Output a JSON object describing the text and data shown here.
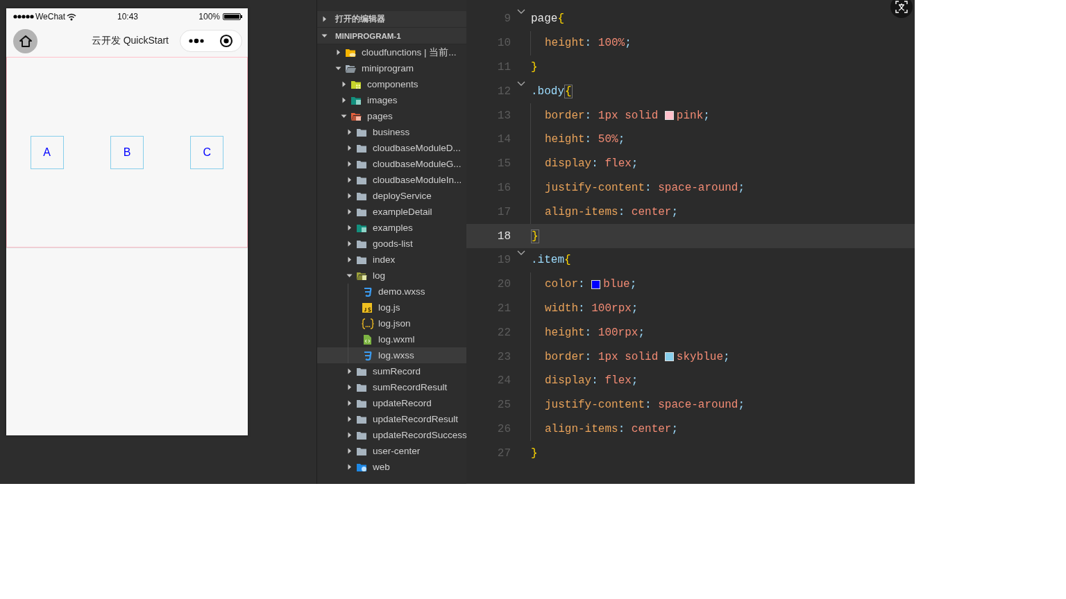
{
  "simulator": {
    "status_bar": {
      "carrier": "WeChat",
      "time": "10:43",
      "battery": "100%"
    },
    "nav_title": "云开发 QuickStart",
    "items": [
      {
        "label": "A"
      },
      {
        "label": "B"
      },
      {
        "label": "C"
      }
    ]
  },
  "explorer": {
    "sections": [
      {
        "label": "打开的编辑器",
        "expanded": false,
        "selected": false
      },
      {
        "label": "MINIPROGRAM-1",
        "expanded": true,
        "selected": false,
        "children": [
          {
            "label": "cloudfunctions | 当前...",
            "kind": "folder-cloud",
            "expanded": false,
            "selected": false
          },
          {
            "label": "miniprogram",
            "kind": "folder",
            "expanded": true,
            "selected": false,
            "children": [
              {
                "label": "components",
                "kind": "folder-components",
                "expanded": false,
                "selected": false
              },
              {
                "label": "images",
                "kind": "folder-images",
                "expanded": false,
                "selected": false
              },
              {
                "label": "pages",
                "kind": "folder-pages",
                "expanded": true,
                "selected": false,
                "children": [
                  {
                    "label": "business",
                    "kind": "folder",
                    "expanded": false,
                    "selected": false
                  },
                  {
                    "label": "cloudbaseModuleD...",
                    "kind": "folder",
                    "expanded": false,
                    "selected": false
                  },
                  {
                    "label": "cloudbaseModuleG...",
                    "kind": "folder",
                    "expanded": false,
                    "selected": false
                  },
                  {
                    "label": "cloudbaseModuleIn...",
                    "kind": "folder",
                    "expanded": false,
                    "selected": false
                  },
                  {
                    "label": "deployService",
                    "kind": "folder",
                    "expanded": false,
                    "selected": false
                  },
                  {
                    "label": "exampleDetail",
                    "kind": "folder",
                    "expanded": false,
                    "selected": false
                  },
                  {
                    "label": "examples",
                    "kind": "folder-images",
                    "expanded": false,
                    "selected": false
                  },
                  {
                    "label": "goods-list",
                    "kind": "folder",
                    "expanded": false,
                    "selected": false
                  },
                  {
                    "label": "index",
                    "kind": "folder",
                    "expanded": false,
                    "selected": false
                  },
                  {
                    "label": "log",
                    "kind": "folder-log",
                    "expanded": true,
                    "selected": false,
                    "children": [
                      {
                        "label": "demo.wxss",
                        "kind": "css",
                        "selected": false
                      },
                      {
                        "label": "log.js",
                        "kind": "js",
                        "selected": false
                      },
                      {
                        "label": "log.json",
                        "kind": "json",
                        "selected": false
                      },
                      {
                        "label": "log.wxml",
                        "kind": "wxml",
                        "selected": false
                      },
                      {
                        "label": "log.wxss",
                        "kind": "css",
                        "selected": true
                      }
                    ]
                  },
                  {
                    "label": "sumRecord",
                    "kind": "folder",
                    "expanded": false,
                    "selected": false
                  },
                  {
                    "label": "sumRecordResult",
                    "kind": "folder",
                    "expanded": false,
                    "selected": false
                  },
                  {
                    "label": "updateRecord",
                    "kind": "folder",
                    "expanded": false,
                    "selected": false
                  },
                  {
                    "label": "updateRecordResult",
                    "kind": "folder",
                    "expanded": false,
                    "selected": false
                  },
                  {
                    "label": "updateRecordSuccess",
                    "kind": "folder",
                    "expanded": false,
                    "selected": false
                  },
                  {
                    "label": "user-center",
                    "kind": "folder",
                    "expanded": false,
                    "selected": false
                  },
                  {
                    "label": "web",
                    "kind": "folder-web",
                    "expanded": false,
                    "selected": false
                  }
                ]
              }
            ]
          }
        ]
      }
    ]
  },
  "editor": {
    "lines": [
      {
        "number": "9",
        "fold": true,
        "current": false,
        "tokens": [
          {
            "kind": "selector",
            "text": "page"
          },
          {
            "kind": "brace",
            "text": "{",
            "matched": false
          }
        ]
      },
      {
        "number": "10",
        "fold": false,
        "current": false,
        "tokens": [
          {
            "kind": "property",
            "text": "height"
          },
          {
            "kind": "punct",
            "text": ": "
          },
          {
            "kind": "value",
            "text": "100%"
          },
          {
            "kind": "punct",
            "text": ";"
          }
        ]
      },
      {
        "number": "11",
        "fold": false,
        "current": false,
        "tokens": [
          {
            "kind": "brace",
            "text": "}",
            "matched": false
          }
        ]
      },
      {
        "number": "12",
        "fold": true,
        "current": false,
        "tokens": [
          {
            "kind": "class",
            "text": ".body"
          },
          {
            "kind": "brace",
            "text": "{",
            "matched": true
          }
        ]
      },
      {
        "number": "13",
        "fold": false,
        "current": false,
        "tokens": [
          {
            "kind": "property",
            "text": "border"
          },
          {
            "kind": "punct",
            "text": ": "
          },
          {
            "kind": "value",
            "text": "1px solid "
          },
          {
            "kind": "swatch",
            "color": "#ffc0cb"
          },
          {
            "kind": "value",
            "text": "pink"
          },
          {
            "kind": "punct",
            "text": ";"
          }
        ]
      },
      {
        "number": "14",
        "fold": false,
        "current": false,
        "tokens": [
          {
            "kind": "property",
            "text": "height"
          },
          {
            "kind": "punct",
            "text": ": "
          },
          {
            "kind": "value",
            "text": "50%"
          },
          {
            "kind": "punct",
            "text": ";"
          }
        ]
      },
      {
        "number": "15",
        "fold": false,
        "current": false,
        "tokens": [
          {
            "kind": "property",
            "text": "display"
          },
          {
            "kind": "punct",
            "text": ": "
          },
          {
            "kind": "value",
            "text": "flex"
          },
          {
            "kind": "punct",
            "text": ";"
          }
        ]
      },
      {
        "number": "16",
        "fold": false,
        "current": false,
        "tokens": [
          {
            "kind": "property",
            "text": "justify-content"
          },
          {
            "kind": "punct",
            "text": ": "
          },
          {
            "kind": "value",
            "text": "space-around"
          },
          {
            "kind": "punct",
            "text": ";"
          }
        ]
      },
      {
        "number": "17",
        "fold": false,
        "current": false,
        "tokens": [
          {
            "kind": "property",
            "text": "align-items"
          },
          {
            "kind": "punct",
            "text": ": "
          },
          {
            "kind": "value",
            "text": "center"
          },
          {
            "kind": "punct",
            "text": ";"
          }
        ]
      },
      {
        "number": "18",
        "fold": false,
        "current": true,
        "tokens": [
          {
            "kind": "brace",
            "text": "}",
            "matched": true
          }
        ]
      },
      {
        "number": "19",
        "fold": true,
        "current": false,
        "tokens": [
          {
            "kind": "class",
            "text": ".item"
          },
          {
            "kind": "brace",
            "text": "{",
            "matched": false
          }
        ]
      },
      {
        "number": "20",
        "fold": false,
        "current": false,
        "tokens": [
          {
            "kind": "property",
            "text": "color"
          },
          {
            "kind": "punct",
            "text": ": "
          },
          {
            "kind": "swatch",
            "color": "#0000ff"
          },
          {
            "kind": "value",
            "text": "blue"
          },
          {
            "kind": "punct",
            "text": ";"
          }
        ]
      },
      {
        "number": "21",
        "fold": false,
        "current": false,
        "tokens": [
          {
            "kind": "property",
            "text": "width"
          },
          {
            "kind": "punct",
            "text": ": "
          },
          {
            "kind": "value",
            "text": "100rpx"
          },
          {
            "kind": "punct",
            "text": ";"
          }
        ]
      },
      {
        "number": "22",
        "fold": false,
        "current": false,
        "tokens": [
          {
            "kind": "property",
            "text": "height"
          },
          {
            "kind": "punct",
            "text": ": "
          },
          {
            "kind": "value",
            "text": "100rpx"
          },
          {
            "kind": "punct",
            "text": ";"
          }
        ]
      },
      {
        "number": "23",
        "fold": false,
        "current": false,
        "tokens": [
          {
            "kind": "property",
            "text": "border"
          },
          {
            "kind": "punct",
            "text": ": "
          },
          {
            "kind": "value",
            "text": "1px solid "
          },
          {
            "kind": "swatch",
            "color": "#87ceeb"
          },
          {
            "kind": "value",
            "text": "skyblue"
          },
          {
            "kind": "punct",
            "text": ";"
          }
        ]
      },
      {
        "number": "24",
        "fold": false,
        "current": false,
        "tokens": [
          {
            "kind": "property",
            "text": "display"
          },
          {
            "kind": "punct",
            "text": ": "
          },
          {
            "kind": "value",
            "text": "flex"
          },
          {
            "kind": "punct",
            "text": ";"
          }
        ]
      },
      {
        "number": "25",
        "fold": false,
        "current": false,
        "tokens": [
          {
            "kind": "property",
            "text": "justify-content"
          },
          {
            "kind": "punct",
            "text": ": "
          },
          {
            "kind": "value",
            "text": "space-around"
          },
          {
            "kind": "punct",
            "text": ";"
          }
        ]
      },
      {
        "number": "26",
        "fold": false,
        "current": false,
        "tokens": [
          {
            "kind": "property",
            "text": "align-items"
          },
          {
            "kind": "punct",
            "text": ": "
          },
          {
            "kind": "value",
            "text": "center"
          },
          {
            "kind": "punct",
            "text": ";"
          }
        ]
      },
      {
        "number": "27",
        "fold": false,
        "current": false,
        "tokens": [
          {
            "kind": "brace",
            "text": "}",
            "matched": false
          }
        ]
      }
    ]
  }
}
